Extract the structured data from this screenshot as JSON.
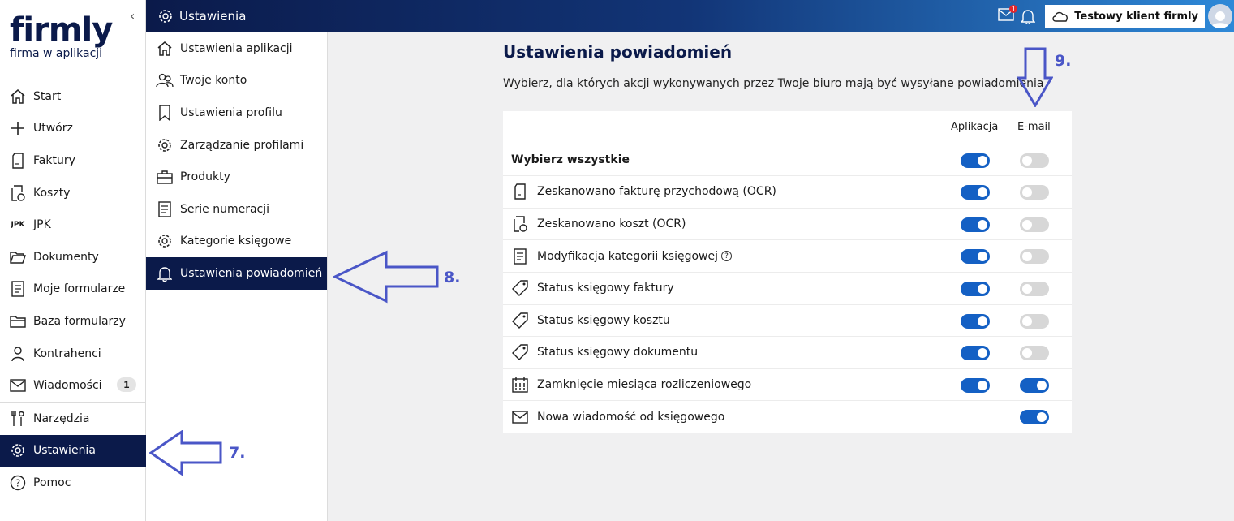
{
  "logo": {
    "word": "firmly",
    "tagline": "firma w aplikacji"
  },
  "sidebar": {
    "collapse_icon": "chevron-left-icon",
    "items": [
      {
        "label": "Start",
        "icon": "home-icon"
      },
      {
        "label": "Utwórz",
        "icon": "plus-icon"
      },
      {
        "label": "Faktury",
        "icon": "invoice-icon"
      },
      {
        "label": "Koszty",
        "icon": "cost-icon"
      },
      {
        "label": "JPK",
        "icon": "jpk-icon",
        "icon_text": "JPK"
      },
      {
        "label": "Dokumenty",
        "icon": "folder-icon"
      },
      {
        "label": "Moje formularze",
        "icon": "form-icon"
      },
      {
        "label": "Baza formularzy",
        "icon": "folders-icon"
      },
      {
        "label": "Kontrahenci",
        "icon": "person-icon"
      },
      {
        "label": "Wiadomości",
        "icon": "mail-icon",
        "badge": "1"
      },
      {
        "label": "Narzędzia",
        "icon": "tools-icon"
      },
      {
        "label": "Ustawienia",
        "icon": "gear-icon"
      },
      {
        "label": "Pomoc",
        "icon": "help-icon"
      }
    ]
  },
  "header": {
    "title": "Ustawienia",
    "mail_badge": "1",
    "client_name": "Testowy klient firmly"
  },
  "submenu": {
    "items": [
      {
        "label": "Ustawienia aplikacji",
        "icon": "home-icon"
      },
      {
        "label": "Twoje konto",
        "icon": "users-icon"
      },
      {
        "label": "Ustawienia profilu",
        "icon": "bookmark-icon"
      },
      {
        "label": "Zarządzanie profilami",
        "icon": "gear-icon"
      },
      {
        "label": "Produkty",
        "icon": "briefcase-icon"
      },
      {
        "label": "Serie numeracji",
        "icon": "document-icon"
      },
      {
        "label": "Kategorie księgowe",
        "icon": "gear-icon"
      },
      {
        "label": "Ustawienia powiadomień",
        "icon": "bell-icon"
      }
    ]
  },
  "main": {
    "title": "Ustawienia powiadomień",
    "description": "Wybierz, dla których akcji wykonywanych przez Twoje biuro mają być wysyłane powiadomienia",
    "col_app": "Aplikacja",
    "col_mail": "E-mail",
    "select_all": "Wybierz wszystkie",
    "rows": [
      {
        "label": "Zeskanowano fakturę przychodową (OCR)",
        "icon": "invoice-icon",
        "app": true,
        "mail": false
      },
      {
        "label": "Zeskanowano koszt (OCR)",
        "icon": "cost-icon",
        "app": true,
        "mail": false
      },
      {
        "label": "Modyfikacja kategorii księgowej",
        "icon": "document-icon",
        "app": true,
        "mail": false,
        "help": "?"
      },
      {
        "label": "Status księgowy faktury",
        "icon": "tag-icon",
        "app": true,
        "mail": false
      },
      {
        "label": "Status księgowy kosztu",
        "icon": "tag-icon",
        "app": true,
        "mail": false
      },
      {
        "label": "Status księgowy dokumentu",
        "icon": "tag-icon",
        "app": true,
        "mail": false
      },
      {
        "label": "Zamknięcie miesiąca rozliczeniowego",
        "icon": "calendar-icon",
        "app": true,
        "mail": true
      },
      {
        "label": "Nowa wiadomość od księgowego",
        "icon": "mail-icon",
        "app": null,
        "mail": true
      }
    ],
    "select_all_app": true,
    "select_all_mail": false
  },
  "annotations": [
    {
      "label": "7."
    },
    {
      "label": "8."
    },
    {
      "label": "9."
    }
  ],
  "colors": {
    "navy": "#0b1a4a",
    "toggle_on": "#1460c4",
    "annotation": "#4a56c7"
  }
}
